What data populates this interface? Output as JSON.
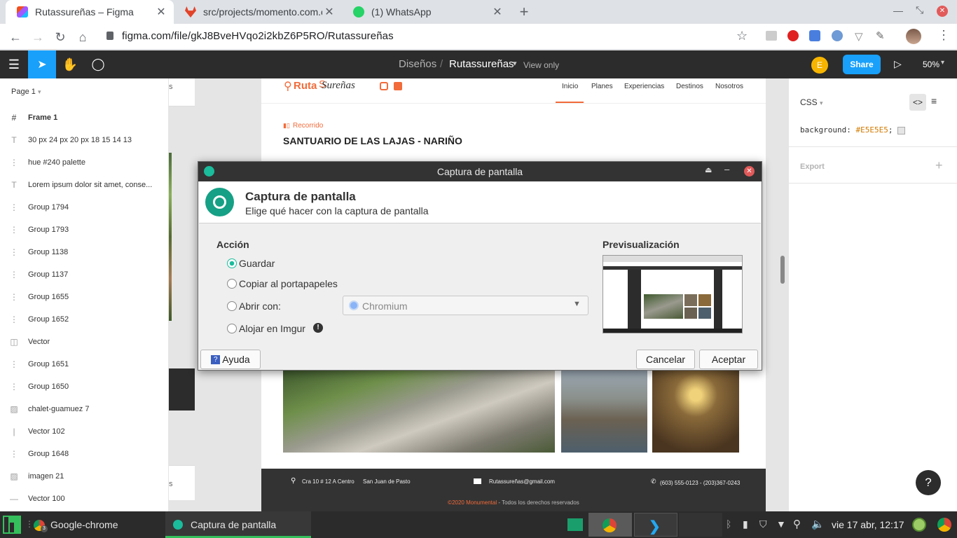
{
  "browser": {
    "tabs": [
      {
        "title": "Rutassureñas – Figma",
        "active": true
      },
      {
        "title": "src/projects/momento.com.c",
        "active": false
      },
      {
        "title": "(1) WhatsApp",
        "active": false
      }
    ],
    "url": "figma.com/file/gkJ8BveHVqo2i2kbZ6P5RO/Rutassureñas"
  },
  "figma": {
    "breadcrumb_root": "Diseños",
    "breadcrumb_sep": "/",
    "file_name": "Rutassureñas",
    "view_mode": "View only",
    "avatar_letter": "E",
    "share_label": "Share",
    "zoom": "50%",
    "page_selector": "Page 1",
    "layers": [
      {
        "icon": "#",
        "label": "Frame 1"
      },
      {
        "icon": "T",
        "label": "30 px 24 px 20 px 18 15 14 13"
      },
      {
        "icon": "⋮",
        "label": "hue #240 palette"
      },
      {
        "icon": "T",
        "label": "Lorem ipsum dolor sit amet, conse..."
      },
      {
        "icon": "⋮",
        "label": "Group 1794"
      },
      {
        "icon": "⋮",
        "label": "Group 1793"
      },
      {
        "icon": "⋮",
        "label": "Group 1138"
      },
      {
        "icon": "⋮",
        "label": "Group 1137"
      },
      {
        "icon": "⋮",
        "label": "Group 1655"
      },
      {
        "icon": "⋮",
        "label": "Group 1652"
      },
      {
        "icon": "◫",
        "label": "Vector"
      },
      {
        "icon": "⋮",
        "label": "Group 1651"
      },
      {
        "icon": "⋮",
        "label": "Group 1650"
      },
      {
        "icon": "▨",
        "label": "chalet-guamuez 7"
      },
      {
        "icon": "|",
        "label": "Vector 102"
      },
      {
        "icon": "⋮",
        "label": "Group 1648"
      },
      {
        "icon": "▨",
        "label": "imagen 21"
      },
      {
        "icon": "—",
        "label": "Vector 100"
      }
    ],
    "right_panel": {
      "css_label": "CSS",
      "css_property": "background:",
      "css_value": "#E5E5E5",
      "css_semicolon": ";",
      "export_label": "Export"
    },
    "help_label": "?"
  },
  "design": {
    "logo_ruta": "Ruta",
    "logo_s": "S",
    "logo_surenas": "Sureñas",
    "nav": [
      "Inicio",
      "Planes",
      "Experiencias",
      "Destinos",
      "Nosotros"
    ],
    "section_tag": "Recorrido",
    "heading": "SANTUARIO DE LAS LAJAS - NARIÑO",
    "footer_address": "Cra 10 # 12 A Centro",
    "footer_city": "San Juan de Pasto",
    "footer_email": "Rutassureñas@gmail.com",
    "footer_phone": "(603) 555-0123 - (203)367-0243",
    "copyright_brand": "©2020 Monumental",
    "copyright_rest": " - Todos los derechos reservados",
    "left_panel_fragment_top": "s",
    "left_panel_fragment_bottom": "s"
  },
  "dialog": {
    "window_title": "Captura de pantalla",
    "heading": "Captura de pantalla",
    "subheading": "Elige qué hacer con la captura de pantalla",
    "action_label": "Acción",
    "options": [
      {
        "label": "Guardar",
        "selected": true
      },
      {
        "label": "Copiar al portapapeles",
        "selected": false
      },
      {
        "label": "Abrir con:",
        "selected": false
      },
      {
        "label": "Alojar en Imgur",
        "selected": false
      }
    ],
    "open_with_value": "Chromium",
    "preview_label": "Previsualización",
    "help_button": "Ayuda",
    "cancel_button": "Cancelar",
    "accept_button": "Aceptar"
  },
  "taskbar": {
    "chrome_label": "Google-chrome",
    "chrome_badge": "3",
    "capture_label": "Captura de pantalla",
    "datetime": "vie 17 abr, 12:17"
  },
  "colors": {
    "figma_dark": "#2c2c2c",
    "figma_blue": "#18a0fb",
    "accent_orange": "#f26b3a",
    "dialog_teal": "#1abc9c"
  }
}
